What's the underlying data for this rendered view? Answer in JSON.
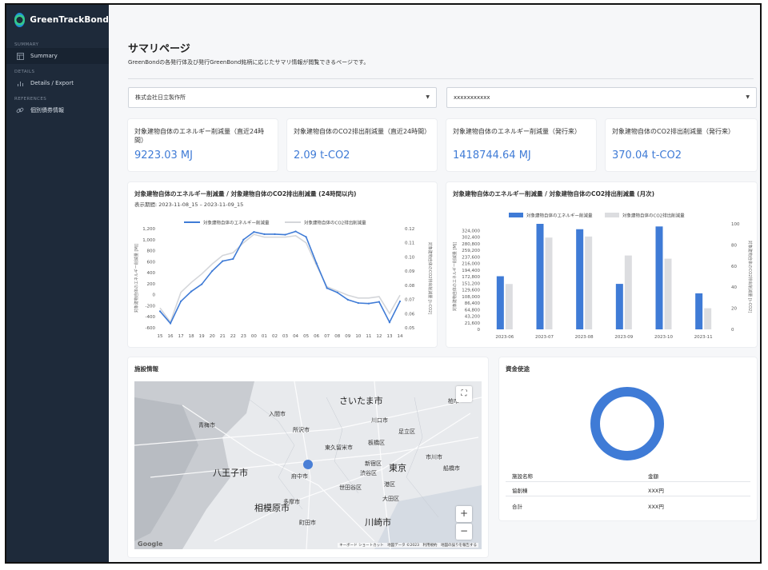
{
  "app": {
    "brand": "GreenTrackBond"
  },
  "sidebar": {
    "sections": [
      {
        "label": "SUMMARY",
        "items": [
          {
            "label": "Summary",
            "icon": "layout-icon",
            "active": true
          }
        ]
      },
      {
        "label": "DETAILS",
        "items": [
          {
            "label": "Details / Export",
            "icon": "bar-chart-icon",
            "active": false
          }
        ]
      },
      {
        "label": "REFERENCES",
        "items": [
          {
            "label": "個別債券情報",
            "icon": "link-icon",
            "active": false
          }
        ]
      }
    ]
  },
  "page": {
    "title": "サマリページ",
    "description": "GreenBondの各発行体及び発行GreenBond銘柄に応じたサマリ情報が閲覧できるページです。"
  },
  "filters": {
    "issuer": {
      "value": "株式会社日立製作所"
    },
    "bond": {
      "value": "xxxxxxxxxxx"
    }
  },
  "kpis": [
    {
      "label": "対象建物自体のエネルギー削減量（直近24時間）",
      "value": "9223.03 MJ"
    },
    {
      "label": "対象建物自体のCO2排出削減量（直近24時間）",
      "value": "2.09 t-CO2"
    },
    {
      "label": "対象建物自体のエネルギー削減量（発行来）",
      "value": "1418744.64 MJ"
    },
    {
      "label": "対象建物自体のCO2排出削減量（発行来）",
      "value": "370.04 t-CO2"
    }
  ],
  "line_card": {
    "title": "対象建物自体のエネルギー削減量 / 対象建物自体のCO2排出削減量 (24時間以内)",
    "period": "表示期間: 2023-11-08_15 – 2023-11-09_15"
  },
  "bar_card": {
    "title": "対象建物自体のエネルギー削減量 / 対象建物自体のCO2排出削減量 (月次)"
  },
  "map_card": {
    "title": "施設情報",
    "labels": [
      "さいたま市",
      "川口市",
      "足立区",
      "板橋区",
      "東京",
      "新宿区",
      "渋谷区",
      "世田谷区",
      "八王子市",
      "府中市",
      "相模原市",
      "川崎市",
      "青梅市",
      "船橋市",
      "市川市",
      "柏市",
      "入間市",
      "所沢市",
      "東久留米市",
      "町田市",
      "多摩市",
      "港区",
      "大田区"
    ],
    "footer": "キーボード ショートカット　地図データ ©2023　利用規約　地図の誤りを報告する",
    "google": "Google",
    "zoom_in": "+",
    "zoom_out": "−",
    "fullscreen": "⛶"
  },
  "fund_card": {
    "title": "資金使途",
    "columns": [
      "施設名称",
      "金額"
    ],
    "rows": [
      [
        "協創棟",
        "XXX円"
      ]
    ],
    "total": [
      "合計",
      "XXX円"
    ],
    "donut": {
      "value": 100,
      "color": "#3f7bd6"
    }
  },
  "chart_data": [
    {
      "type": "line",
      "title": "対象建物自体のエネルギー削減量 / 対象建物自体のCO2排出削減量 (24時間以内)",
      "x": [
        "15",
        "16",
        "17",
        "18",
        "19",
        "20",
        "21",
        "22",
        "23",
        "00",
        "01",
        "02",
        "03",
        "04",
        "05",
        "06",
        "07",
        "08",
        "09",
        "10",
        "11",
        "12",
        "13",
        "14"
      ],
      "ylabel": "対象建物自体のエネルギー削減量 [MJ]",
      "y2label": "対象建物自体のCO2排出削減量 [t-CO2]",
      "ylim": [
        -600,
        1200
      ],
      "y2lim": [
        0.05,
        0.12
      ],
      "yticks": [
        -600,
        -400,
        -200,
        0,
        200,
        400,
        600,
        800,
        1000,
        1200
      ],
      "y2ticks": [
        0.05,
        0.06,
        0.07,
        0.08,
        0.09,
        0.1,
        0.11,
        0.12
      ],
      "series": [
        {
          "name": "対象建物自体のエネルギー削減量",
          "axis": "left",
          "color": "#3f7bd6",
          "values": [
            -300,
            -520,
            -120,
            60,
            190,
            430,
            610,
            650,
            1000,
            1140,
            1100,
            1100,
            1090,
            1150,
            1050,
            570,
            120,
            40,
            -90,
            -150,
            -160,
            -130,
            -500,
            -120
          ]
        },
        {
          "name": "対象建物自体のCO2排出削減量",
          "axis": "right",
          "color": "#d4d6da",
          "values": [
            0.064,
            0.054,
            0.075,
            0.082,
            0.088,
            0.095,
            0.101,
            0.103,
            0.11,
            0.116,
            0.114,
            0.114,
            0.114,
            0.115,
            0.11,
            0.094,
            0.079,
            0.076,
            0.073,
            0.071,
            0.071,
            0.072,
            0.06,
            0.073
          ]
        }
      ],
      "legend": "top"
    },
    {
      "type": "bar",
      "title": "対象建物自体のエネルギー削減量 / 対象建物自体のCO2排出削減量 (月次)",
      "categories": [
        "2023-06",
        "2023-07",
        "2023-08",
        "2023-09",
        "2023-10",
        "2023-11"
      ],
      "ylabel": "対象建物自体のエネルギー削減量 [MJ]",
      "y2label": "対象建物自体のCO2排出削減量 [t-CO2]",
      "ylim": [
        0,
        345600
      ],
      "y2lim": [
        0,
        100
      ],
      "yticks": [
        0,
        21600,
        43200,
        64800,
        86400,
        108000,
        129600,
        151200,
        172800,
        194400,
        216000,
        237600,
        259200,
        280800,
        302400,
        324000
      ],
      "y2ticks": [
        0,
        20,
        40,
        60,
        80,
        100
      ],
      "series": [
        {
          "name": "対象建物自体のエネルギー削減量",
          "axis": "left",
          "color": "#3f7bd6",
          "values": [
            174000,
            345600,
            328000,
            149000,
            337000,
            118000
          ]
        },
        {
          "name": "対象建物自体のCO2排出削減量",
          "axis": "right",
          "color": "#dcdde0",
          "values": [
            43,
            87,
            88,
            70,
            67,
            20
          ]
        }
      ],
      "legend": "top"
    }
  ]
}
